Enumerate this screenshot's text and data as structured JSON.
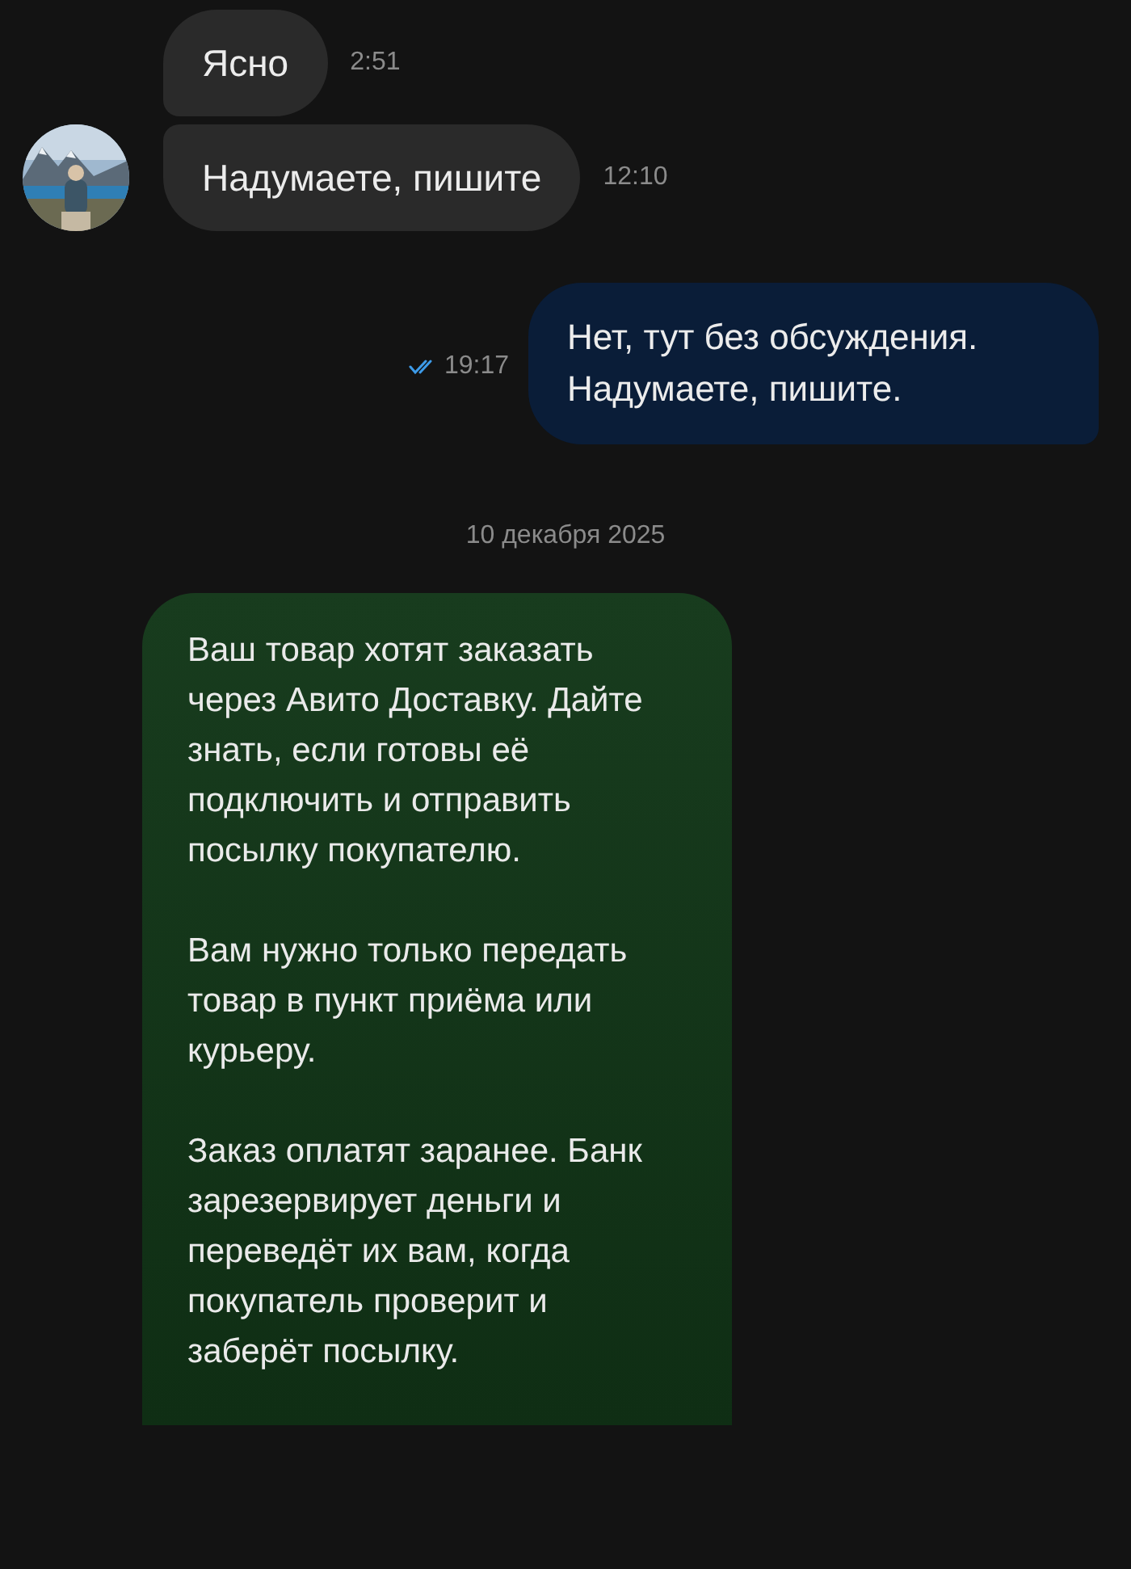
{
  "messages": [
    {
      "kind": "incoming",
      "avatar": false,
      "text": "Ясно",
      "time": "2:51"
    },
    {
      "kind": "incoming",
      "avatar": true,
      "text": "Надумаете, пишите",
      "time": "12:10"
    },
    {
      "kind": "outgoing",
      "text": "Нет, тут без обсуждения.\nНадумаете, пишите.",
      "time": "19:17",
      "read": true
    },
    {
      "kind": "date",
      "text": "10 декабря 2025"
    },
    {
      "kind": "system",
      "paragraphs": [
        "Ваш товар хотят заказать через Авито Доставку. Дайте знать, если готовы её подключить и отправить посылку покупателю.",
        "Вам нужно только передать товар в пункт приёма или курьеру.",
        "Заказ оплатят заранее. Банк зарезервирует деньги и переведёт их вам, когда покупатель проверит и заберёт посылку."
      ]
    }
  ]
}
